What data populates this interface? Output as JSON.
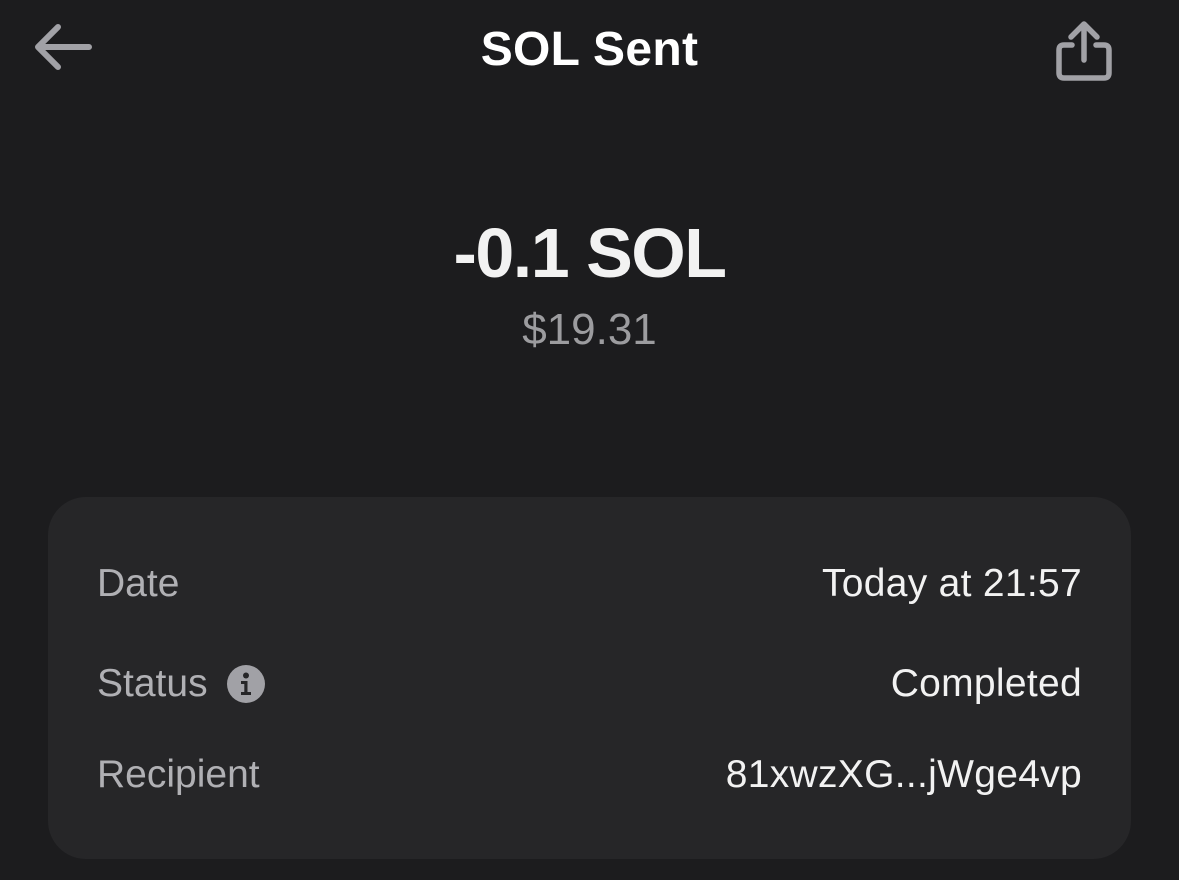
{
  "header": {
    "title": "SOL Sent",
    "back_icon": "arrow-left-icon",
    "share_icon": "share-icon"
  },
  "amount": {
    "crypto": "-0.1 SOL",
    "fiat": "$19.31"
  },
  "details": {
    "date": {
      "label": "Date",
      "value": "Today at 21:57"
    },
    "status": {
      "label": "Status",
      "value": "Completed",
      "icon": "info-icon"
    },
    "recipient": {
      "label": "Recipient",
      "value": "81xwzXG...jWge4vp"
    }
  },
  "colors": {
    "background": "#1c1c1e",
    "card": "#262628",
    "primary_text": "#ffffff",
    "secondary_text": "#9c9c9f",
    "icon": "#a1a1a6"
  }
}
